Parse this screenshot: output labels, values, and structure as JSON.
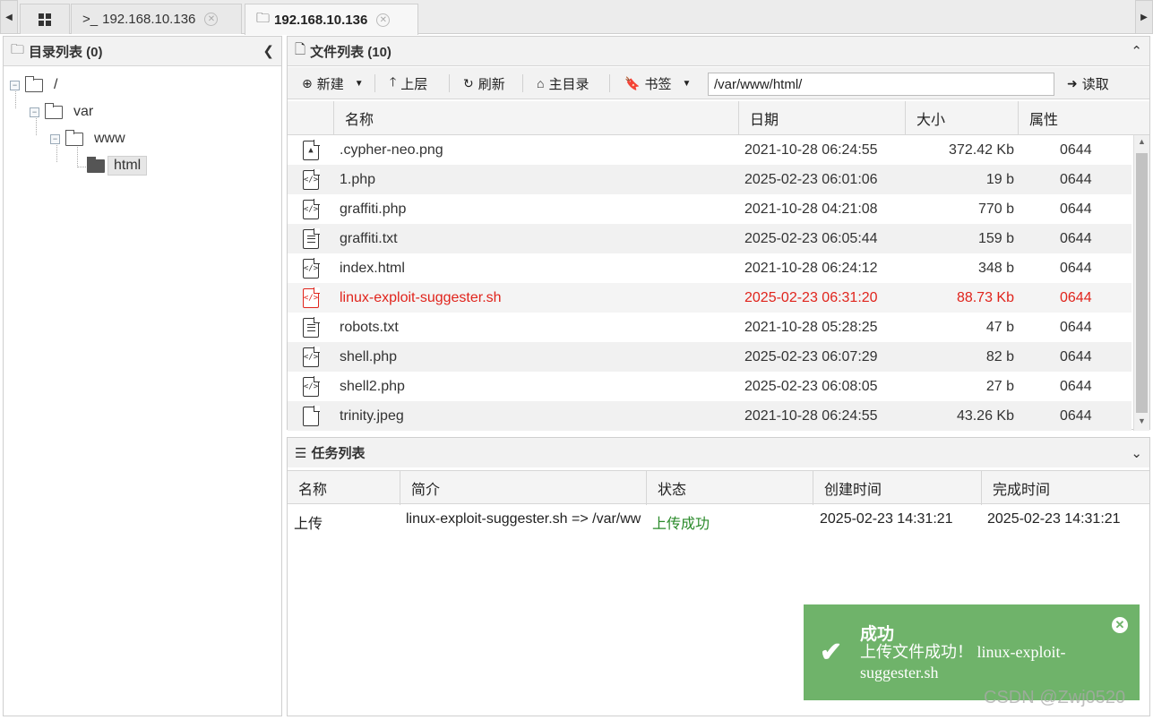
{
  "tabs": [
    {
      "label": "192.168.10.136",
      "prefix": ">_"
    },
    {
      "label": "192.168.10.136"
    }
  ],
  "dir_panel": {
    "title": "目录列表 (0)"
  },
  "tree": [
    {
      "label": "/"
    },
    {
      "label": "var"
    },
    {
      "label": "www"
    },
    {
      "label": "html"
    }
  ],
  "file_panel": {
    "title": "文件列表 (10)"
  },
  "toolbar": {
    "new_label": "新建",
    "up_label": "上层",
    "refresh_label": "刷新",
    "home_label": "主目录",
    "bookmark_label": "书签",
    "path_value": "/var/www/html/",
    "read_label": "读取"
  },
  "file_columns": {
    "name": "名称",
    "date": "日期",
    "size": "大小",
    "attr": "属性"
  },
  "files": [
    {
      "name": ".cypher-neo.png",
      "date": "2021-10-28 06:24:55",
      "size": "372.42 Kb",
      "attr": "0644",
      "icon": "image-file-icon"
    },
    {
      "name": "1.php",
      "date": "2025-02-23 06:01:06",
      "size": "19 b",
      "attr": "0644",
      "icon": "code-file-icon"
    },
    {
      "name": "graffiti.php",
      "date": "2021-10-28 04:21:08",
      "size": "770 b",
      "attr": "0644",
      "icon": "code-file-icon"
    },
    {
      "name": "graffiti.txt",
      "date": "2025-02-23 06:05:44",
      "size": "159 b",
      "attr": "0644",
      "icon": "text-file-icon"
    },
    {
      "name": "index.html",
      "date": "2021-10-28 06:24:12",
      "size": "348 b",
      "attr": "0644",
      "icon": "code-file-icon"
    },
    {
      "name": "linux-exploit-suggester.sh",
      "date": "2025-02-23 06:31:20",
      "size": "88.73 Kb",
      "attr": "0644",
      "icon": "code-file-icon"
    },
    {
      "name": "robots.txt",
      "date": "2021-10-28 05:28:25",
      "size": "47 b",
      "attr": "0644",
      "icon": "text-file-icon"
    },
    {
      "name": "shell.php",
      "date": "2025-02-23 06:07:29",
      "size": "82 b",
      "attr": "0644",
      "icon": "code-file-icon"
    },
    {
      "name": "shell2.php",
      "date": "2025-02-23 06:08:05",
      "size": "27 b",
      "attr": "0644",
      "icon": "code-file-icon"
    },
    {
      "name": "trinity.jpeg",
      "date": "2021-10-28 06:24:55",
      "size": "43.26 Kb",
      "attr": "0644",
      "icon": "blank-file-icon"
    }
  ],
  "task_panel": {
    "title": "任务列表"
  },
  "task_columns": {
    "name": "名称",
    "desc": "简介",
    "status": "状态",
    "created": "创建时间",
    "finished": "完成时间"
  },
  "tasks": [
    {
      "name": "上传",
      "desc": "linux-exploit-suggester.sh => /var/ww",
      "status": "上传成功",
      "created": "2025-02-23 14:31:21",
      "finished": "2025-02-23 14:31:21"
    }
  ],
  "toast": {
    "title": "成功",
    "message": "上传文件成功！ linux-exploit-suggester.sh"
  },
  "watermark": "CSDN @Zwj0520",
  "colors": {
    "highlight_row": "#e0241c",
    "toast_bg": "#6fb36a",
    "success_text": "#2a8a2a"
  }
}
